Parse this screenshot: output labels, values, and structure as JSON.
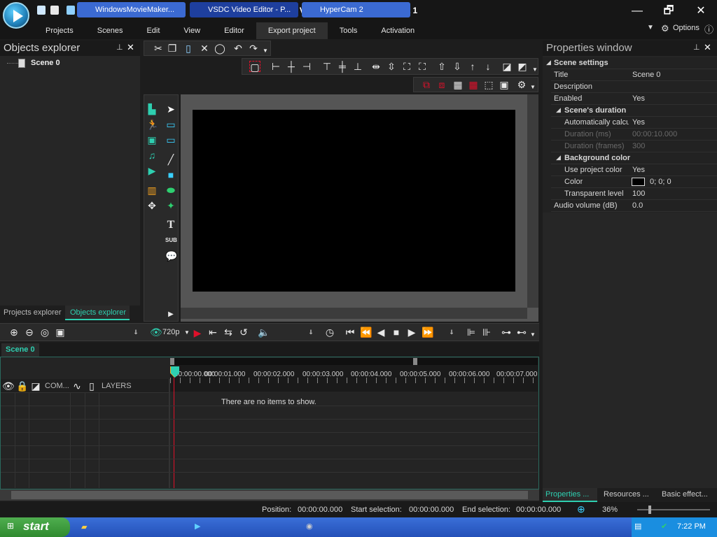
{
  "window": {
    "title": "VSDC Video Editor - Project 1",
    "min": "—",
    "restore": "🗗",
    "close": "✕"
  },
  "menu": [
    "Projects",
    "Scenes",
    "Edit",
    "View",
    "Editor",
    "Export project",
    "Tools",
    "Activation"
  ],
  "options_label": "Options",
  "help": "ⓘ",
  "objects_explorer": {
    "title": "Objects explorer",
    "pin": "📌",
    "close": "✕",
    "tree_item": "Scene 0",
    "tab_projects": "Projects explorer",
    "tab_objects": "Objects explorer"
  },
  "properties": {
    "title": "Properties window",
    "pin": "📌",
    "close": "✕",
    "rows": [
      {
        "k": "Scene settings",
        "v": "",
        "type": "section"
      },
      {
        "k": "Title",
        "v": "Scene 0"
      },
      {
        "k": "Description",
        "v": ""
      },
      {
        "k": "Enabled",
        "v": "Yes"
      },
      {
        "k": "Scene's duration",
        "v": "",
        "type": "sub"
      },
      {
        "k": "Automatically calcul",
        "v": "Yes",
        "indent": true
      },
      {
        "k": "Duration (ms)",
        "v": "00:00:10.000",
        "indent": true,
        "dim": true
      },
      {
        "k": "Duration (frames)",
        "v": "300",
        "indent": true,
        "dim": true
      },
      {
        "k": "Background color",
        "v": "",
        "type": "sub"
      },
      {
        "k": "Use project color",
        "v": "Yes",
        "indent": true
      },
      {
        "k": "Color",
        "v": "0; 0; 0",
        "indent": true,
        "swatch": true
      },
      {
        "k": "Transparent level",
        "v": "100",
        "indent": true
      },
      {
        "k": "Audio volume (dB)",
        "v": "0.0"
      }
    ],
    "tabs": [
      "Properties ...",
      "Resources ...",
      "Basic effect..."
    ]
  },
  "preview": {
    "resolution": "720p"
  },
  "timeline": {
    "scene_tab": "Scene 0",
    "com_label": "COM...",
    "layers_label": "LAYERS",
    "empty": "There are no items to show.",
    "ticks": [
      "00:00:00.000",
      "00:00:01.000",
      "00:00:02.000",
      "00:00:03.000",
      "00:00:04.000",
      "00:00:05.000",
      "00:00:06.000",
      "00:00:07.000"
    ]
  },
  "status": {
    "position_label": "Position:",
    "position": "00:00:00.000",
    "start_label": "Start selection:",
    "start": "00:00:00.000",
    "end_label": "End selection:",
    "end": "00:00:00.000",
    "zoom": "36%"
  },
  "taskbar": {
    "start": "start",
    "items": [
      "WindowsMovieMaker...",
      "VSDC Video Editor - P...",
      "HyperCam 2"
    ],
    "clock": "7:22 PM"
  },
  "colors": {
    "accent": "#2ecfb0",
    "canvas": "#000000",
    "record": "#e0102a"
  }
}
